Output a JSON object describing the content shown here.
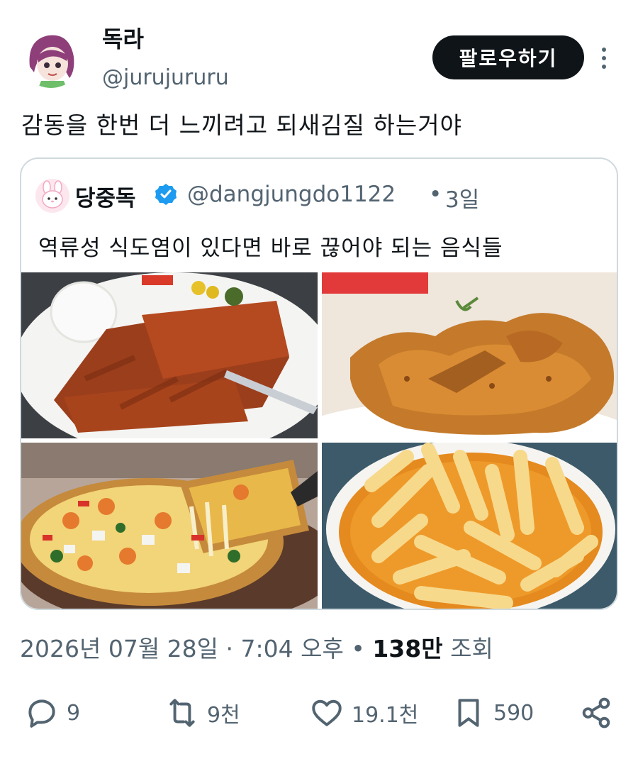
{
  "author": {
    "display_name": "독라",
    "handle": "@jurujururu"
  },
  "follow_label": "팔로우하기",
  "post_text": "감동을 한번 더 느끼려고 되새김질 하는거야",
  "quote": {
    "display_name": "당중독",
    "handle": "@dangjungdo1122",
    "separator": "•",
    "time": "3일",
    "text": "역류성 식도염이 있다면 바로 끊어야 되는 음식들",
    "images": [
      {
        "name": "tonkatsu-image"
      },
      {
        "name": "fried-chicken-image"
      },
      {
        "name": "pizza-image"
      },
      {
        "name": "tteokbokki-image"
      }
    ]
  },
  "meta": {
    "date": "2026년 07월 28일",
    "dot1": "·",
    "time": "7:04 오후",
    "dot2": "•",
    "views_count": "138만",
    "views_label": "조회"
  },
  "actions": {
    "replies": "9",
    "reposts": "9천",
    "likes": "19.1천",
    "bookmarks": "590"
  },
  "colors": {
    "text_primary": "#0f1419",
    "text_secondary": "#536471",
    "border": "#cfd9de",
    "verified": "#1d9bf0",
    "button_bg": "#0f1419"
  }
}
